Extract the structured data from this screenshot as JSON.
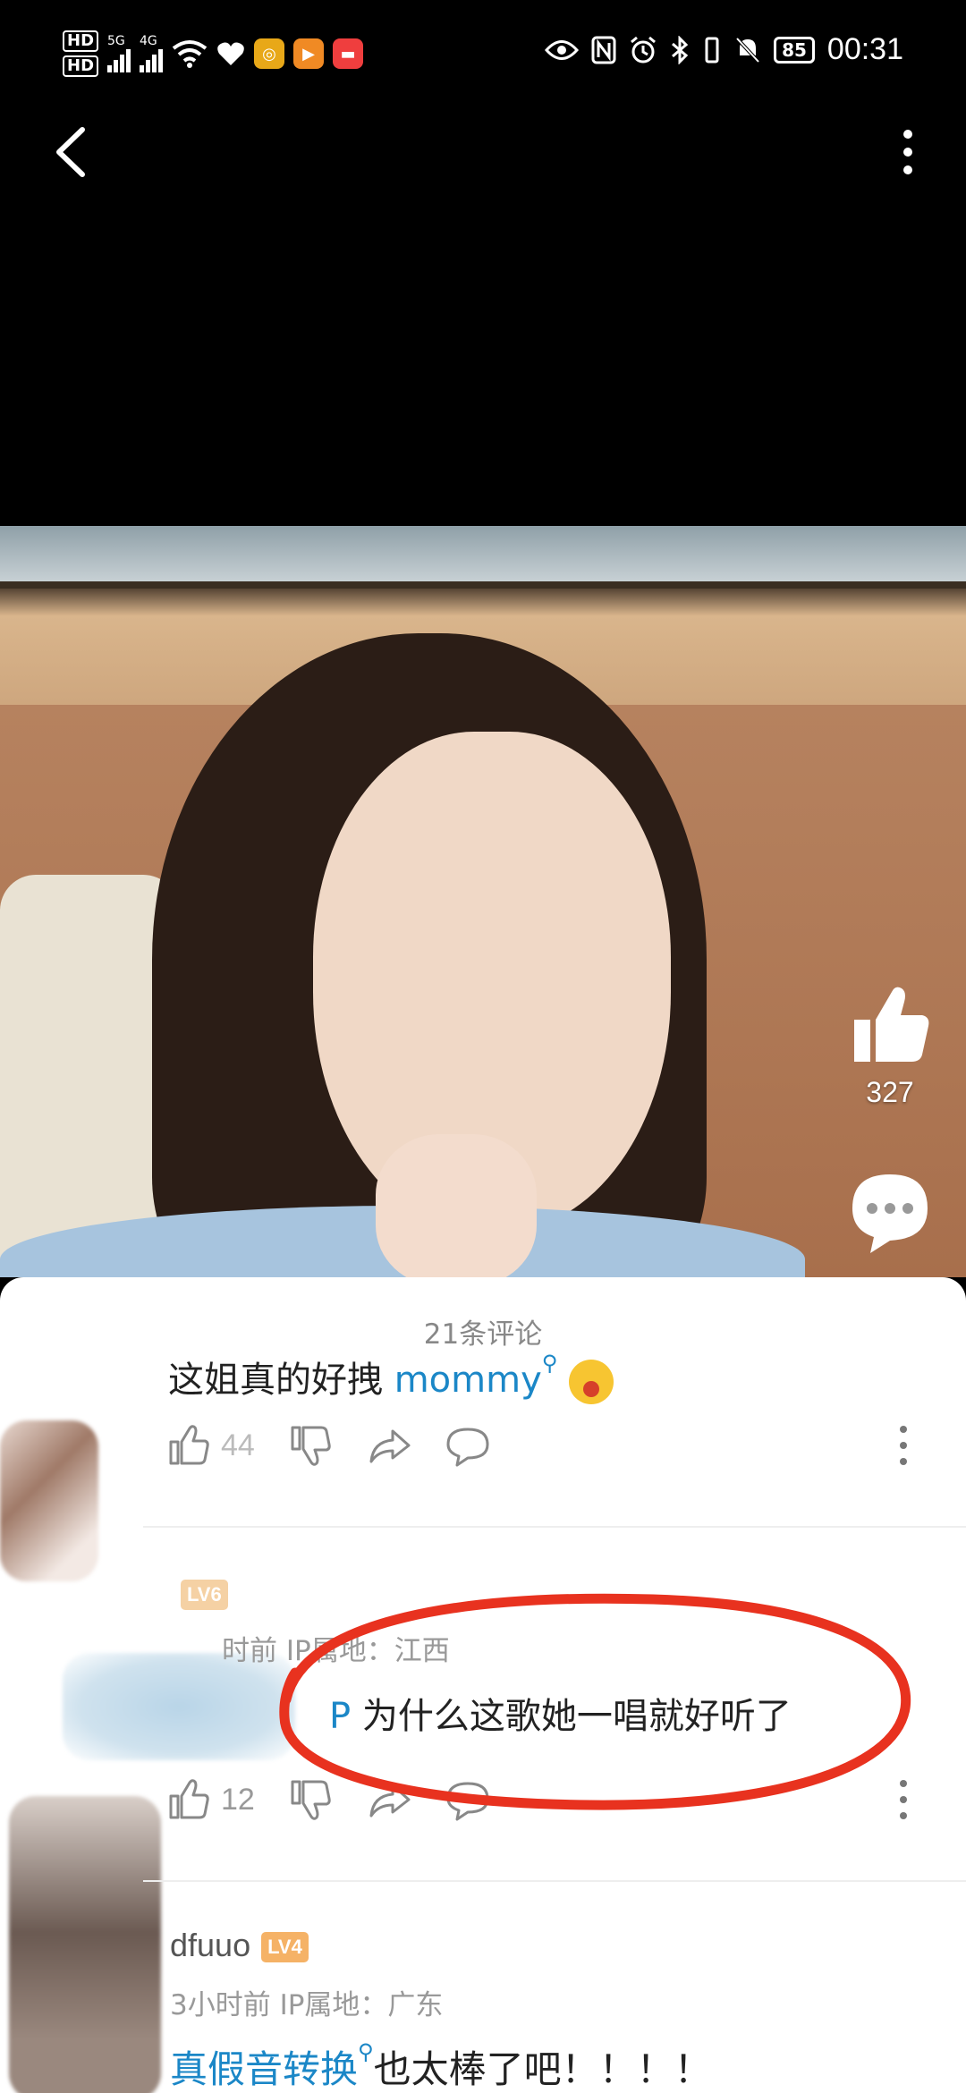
{
  "status_bar": {
    "hd1": "HD",
    "hd2": "HD",
    "net1": "5G",
    "net2": "4G",
    "battery": "85",
    "time": "00:31"
  },
  "video": {
    "like_count": "327"
  },
  "comments_sheet": {
    "title": "21条评论",
    "comments": [
      {
        "text_prefix": "这姐真的好拽",
        "mention": "mommy",
        "actions": {
          "like_count": "44"
        }
      },
      {
        "username": "",
        "level": "LV6",
        "meta_time": "时前",
        "meta_ip": "IP属地：江西",
        "mention": "P",
        "text": "为什么这歌她一唱就好听了",
        "actions": {
          "like_count": "12"
        }
      },
      {
        "username": "dfuuo",
        "level": "LV4",
        "meta_time": "3小时前",
        "meta_ip": "IP属地：广东",
        "mention": "真假音转换",
        "text": "也太棒了吧！！！！"
      }
    ]
  },
  "colors": {
    "mention": "#1b87c7",
    "annotation_circle": "#e8321f",
    "level_badge": "#f5b266"
  }
}
